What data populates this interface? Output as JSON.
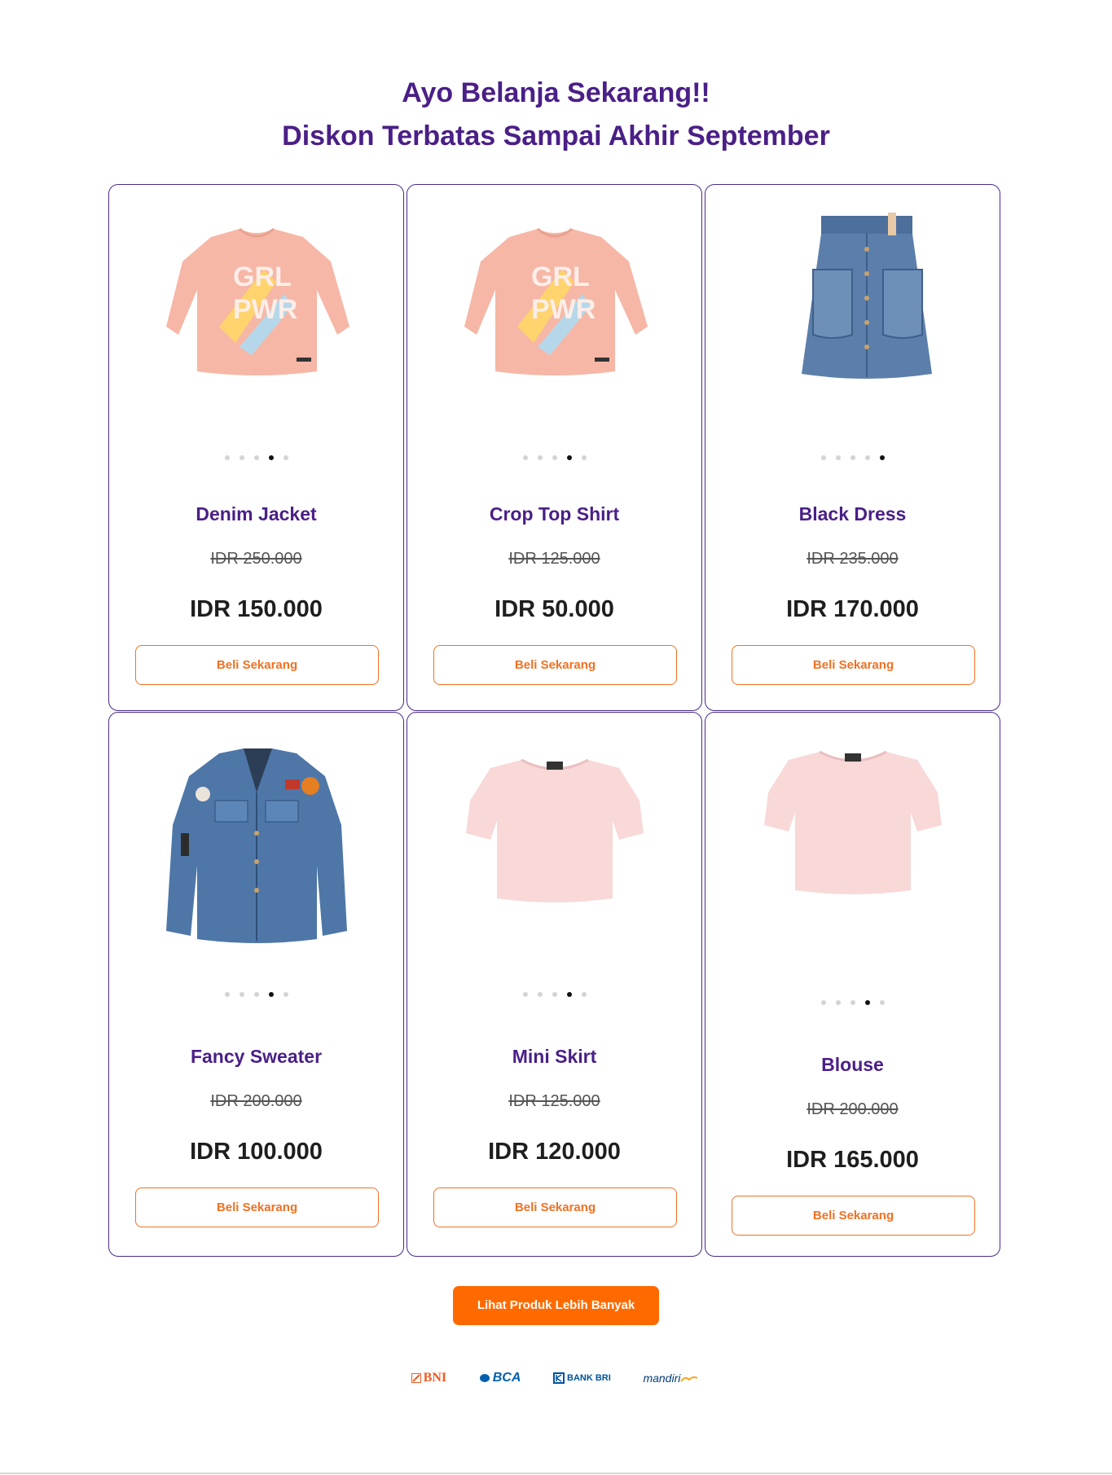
{
  "heading": {
    "line1": "Ayo Belanja Sekarang!!",
    "line2": "Diskon Terbatas Sampai Akhir September"
  },
  "products": [
    {
      "name": "Denim Jacket",
      "old_price": "IDR 250.000",
      "price": "IDR 150.000",
      "button": "Beli Sekarang",
      "image": "pink-sweatshirt-grl-pwr",
      "active_dot": 4,
      "dot_count": 5
    },
    {
      "name": "Crop Top Shirt",
      "old_price": "IDR 125.000",
      "price": "IDR 50.000",
      "button": "Beli Sekarang",
      "image": "pink-sweatshirt-grl-pwr",
      "active_dot": 4,
      "dot_count": 5
    },
    {
      "name": "Black Dress",
      "old_price": "IDR 235.000",
      "price": "IDR 170.000",
      "button": "Beli Sekarang",
      "image": "denim-skirt",
      "active_dot": 5,
      "dot_count": 5
    },
    {
      "name": "Fancy Sweater",
      "old_price": "IDR 200.000",
      "price": "IDR 100.000",
      "button": "Beli Sekarang",
      "image": "denim-jacket-patches",
      "active_dot": 4,
      "dot_count": 5
    },
    {
      "name": "Mini Skirt",
      "old_price": "IDR 125.000",
      "price": "IDR 120.000",
      "button": "Beli Sekarang",
      "image": "pink-crop-top",
      "active_dot": 4,
      "dot_count": 5
    },
    {
      "name": "Blouse",
      "old_price": "IDR 200.000",
      "price": "IDR 165.000",
      "button": "Beli Sekarang",
      "image": "pink-crop-top",
      "active_dot": 4,
      "dot_count": 5
    }
  ],
  "more_button": "Lihat Produk Lebih Banyak",
  "banks": [
    {
      "label": "BNI",
      "icon": "bni-logo"
    },
    {
      "label": "BCA",
      "icon": "bca-logo"
    },
    {
      "label": "BANK BRI",
      "icon": "bri-logo"
    },
    {
      "label": "mandiri",
      "icon": "mandiri-logo"
    }
  ],
  "colors": {
    "heading": "#4a1f87",
    "accent": "#f37021",
    "cta": "#ff6a00",
    "card_border": "#4a2a8a"
  }
}
